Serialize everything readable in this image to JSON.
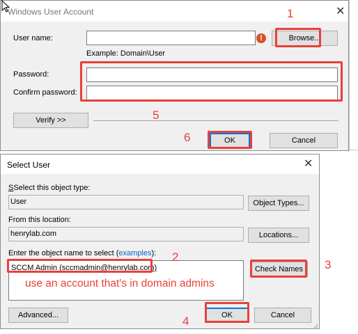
{
  "wua": {
    "title": "Windows User Account",
    "user_name_label": "User name:",
    "user_name_value": "",
    "browse_label": "Browse...",
    "example": "Example: Domain\\User",
    "password_label": "Password:",
    "confirm_label": "Confirm password:",
    "verify_label": "Verify >>",
    "ok_label": "OK",
    "cancel_label": "Cancel"
  },
  "su": {
    "title": "Select User",
    "object_type_label": "Select this object type:",
    "object_type_value": "User",
    "object_types_btn": "Object Types...",
    "location_label": "From this location:",
    "location_value": "henrylab.com",
    "locations_btn": "Locations...",
    "enter_label": "Enter the object name to select (",
    "enter_link": "examples",
    "enter_suffix": "):",
    "object_name_value": "SCCM Admin (sccmadmin@henrylab.com)",
    "check_names_btn": "Check Names",
    "advanced_btn": "Advanced...",
    "ok_label": "OK",
    "cancel_label": "Cancel"
  },
  "annotations": {
    "n1": "1",
    "n2": "2",
    "n3": "3",
    "n4": "4",
    "n5": "5",
    "n6": "6",
    "note": "use an account that's in domain admins"
  },
  "colors": {
    "annotation_red": "#e8403a",
    "default_button_border": "#0078d7",
    "dialog_bg": "#f0f0f0",
    "link": "#0066cc"
  },
  "icons": [
    "warning-icon",
    "close-icon",
    "cursor-icon"
  ]
}
